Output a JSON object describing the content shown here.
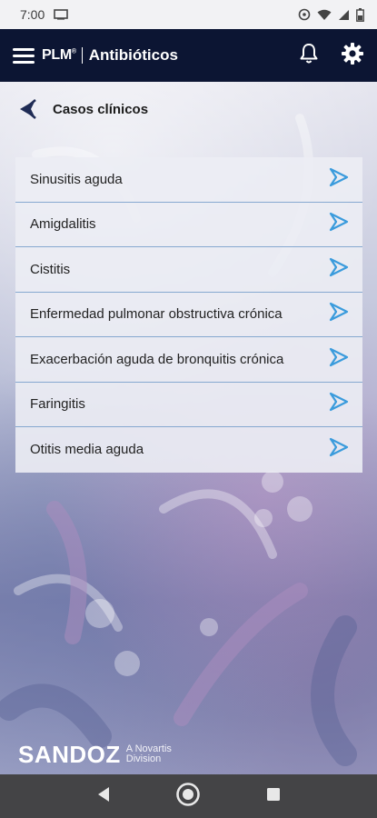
{
  "status_bar": {
    "time": "7:00",
    "icons": [
      "cast-icon",
      "sync-icon",
      "wifi-icon",
      "signal-icon",
      "battery-icon"
    ]
  },
  "app_bar": {
    "brand": "PLM",
    "brand_mark": "®",
    "title": "Antibióticos",
    "background_color": "#0c1533"
  },
  "sub_header": {
    "title": "Casos clínicos"
  },
  "cases": [
    {
      "label": "Sinusitis aguda"
    },
    {
      "label": "Amigdalitis"
    },
    {
      "label": "Cistitis"
    },
    {
      "label": "Enfermedad pulmonar obstructiva crónica"
    },
    {
      "label": "Exacerbación aguda de bronquitis crónica"
    },
    {
      "label": "Faringitis"
    },
    {
      "label": "Otitis media aguda"
    }
  ],
  "accent_color": "#3a9bdc",
  "footer": {
    "company": "SANDOZ",
    "tagline_line1": "A Novartis",
    "tagline_line2": "Division"
  },
  "nav_bar": {
    "buttons": [
      "back-icon",
      "home-icon",
      "recents-icon"
    ]
  }
}
